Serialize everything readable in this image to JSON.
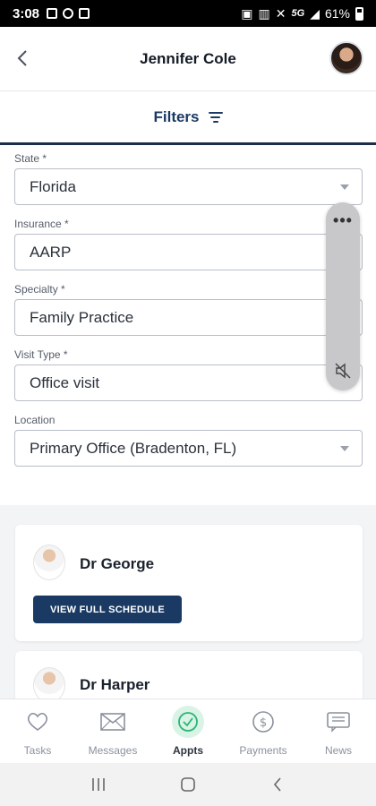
{
  "status_bar": {
    "time": "3:08",
    "network": "5G",
    "battery": "61%"
  },
  "header": {
    "title": "Jennifer Cole"
  },
  "filters": {
    "label": "Filters"
  },
  "form": {
    "state": {
      "label": "State *",
      "value": "Florida"
    },
    "insurance": {
      "label": "Insurance *",
      "value": "AARP"
    },
    "specialty": {
      "label": "Specialty *",
      "value": "Family Practice"
    },
    "visit_type": {
      "label": "Visit Type *",
      "value": "Office visit"
    },
    "location": {
      "label": "Location",
      "value": "Primary Office (Bradenton, FL)"
    }
  },
  "side_panel": {
    "menu": "•••"
  },
  "doctors": [
    {
      "name": "Dr George",
      "button": "VIEW FULL SCHEDULE"
    },
    {
      "name": "Dr Harper"
    }
  ],
  "bottom_nav": {
    "items": [
      {
        "label": "Tasks",
        "icon": "heart-icon"
      },
      {
        "label": "Messages",
        "icon": "envelope-icon"
      },
      {
        "label": "Appts",
        "icon": "clock-check-icon",
        "active": true
      },
      {
        "label": "Payments",
        "icon": "dollar-icon"
      },
      {
        "label": "News",
        "icon": "news-icon"
      }
    ]
  },
  "colors": {
    "primary": "#1b3a63",
    "active_bg": "#d9f3e6"
  }
}
